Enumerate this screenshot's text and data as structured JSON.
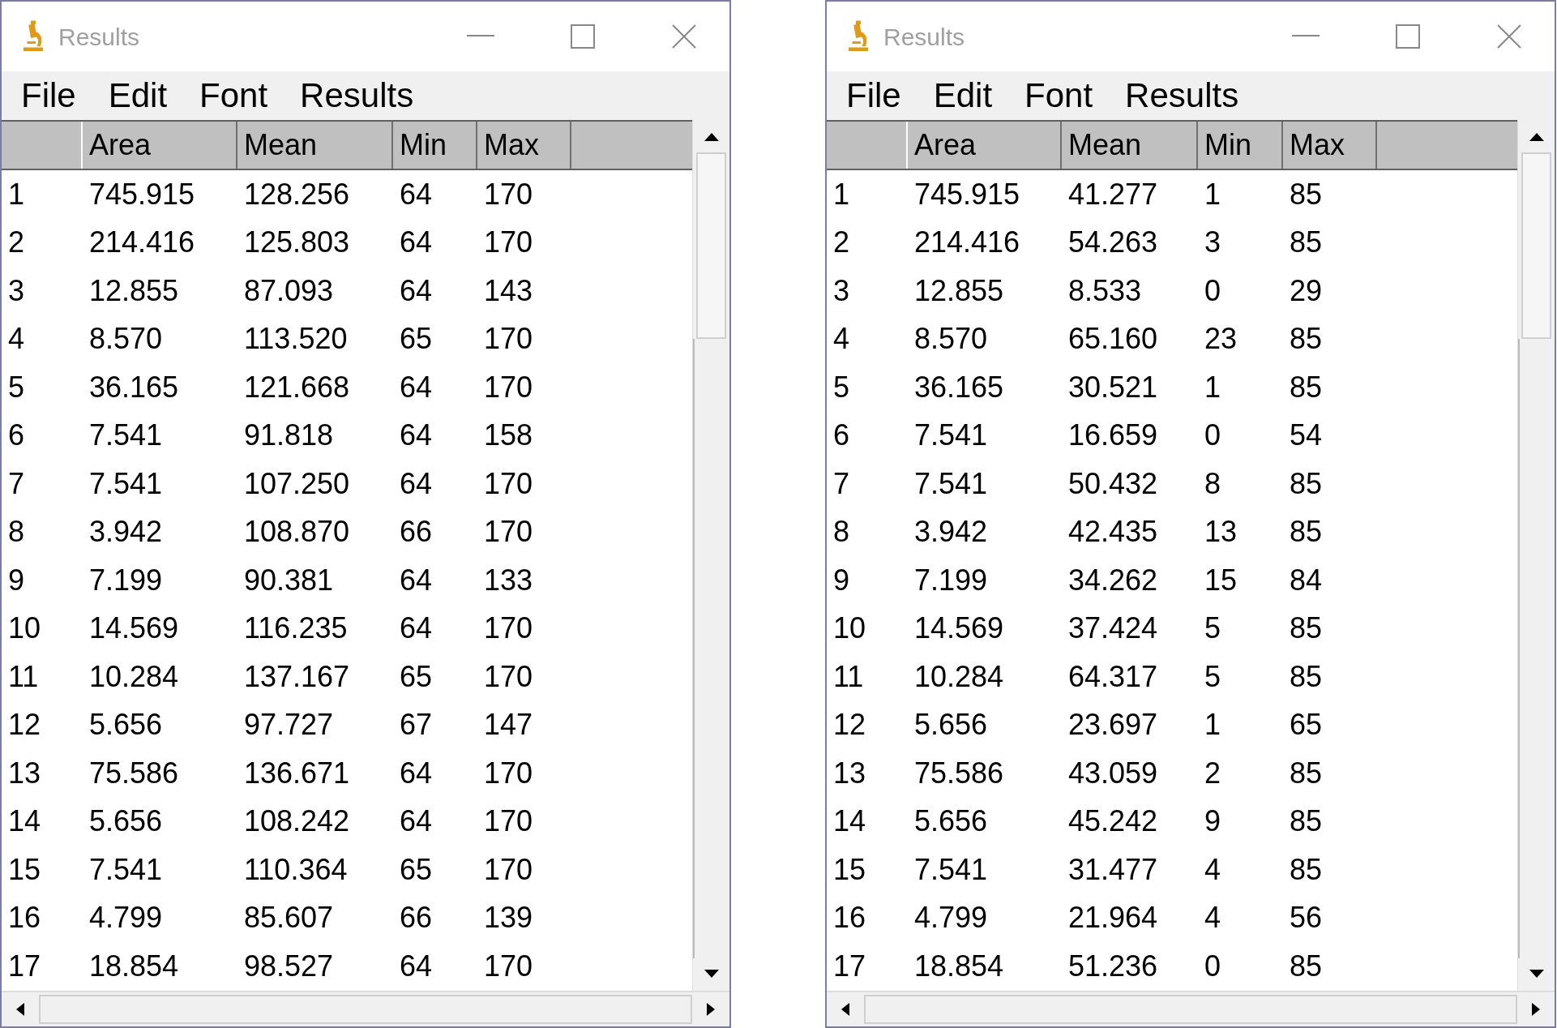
{
  "windows": [
    {
      "title": "Results",
      "menu": [
        "File",
        "Edit",
        "Font",
        "Results"
      ],
      "columns": [
        "",
        "Area",
        "Mean",
        "Min",
        "Max"
      ],
      "rows": [
        [
          "1",
          "745.915",
          "128.256",
          "64",
          "170"
        ],
        [
          "2",
          "214.416",
          "125.803",
          "64",
          "170"
        ],
        [
          "3",
          "12.855",
          "87.093",
          "64",
          "143"
        ],
        [
          "4",
          "8.570",
          "113.520",
          "65",
          "170"
        ],
        [
          "5",
          "36.165",
          "121.668",
          "64",
          "170"
        ],
        [
          "6",
          "7.541",
          "91.818",
          "64",
          "158"
        ],
        [
          "7",
          "7.541",
          "107.250",
          "64",
          "170"
        ],
        [
          "8",
          "3.942",
          "108.870",
          "66",
          "170"
        ],
        [
          "9",
          "7.199",
          "90.381",
          "64",
          "133"
        ],
        [
          "10",
          "14.569",
          "116.235",
          "64",
          "170"
        ],
        [
          "11",
          "10.284",
          "137.167",
          "65",
          "170"
        ],
        [
          "12",
          "5.656",
          "97.727",
          "67",
          "147"
        ],
        [
          "13",
          "75.586",
          "136.671",
          "64",
          "170"
        ],
        [
          "14",
          "5.656",
          "108.242",
          "64",
          "170"
        ],
        [
          "15",
          "7.541",
          "110.364",
          "65",
          "170"
        ],
        [
          "16",
          "4.799",
          "85.607",
          "66",
          "139"
        ],
        [
          "17",
          "18.854",
          "98.527",
          "64",
          "170"
        ]
      ]
    },
    {
      "title": "Results",
      "menu": [
        "File",
        "Edit",
        "Font",
        "Results"
      ],
      "columns": [
        "",
        "Area",
        "Mean",
        "Min",
        "Max"
      ],
      "rows": [
        [
          "1",
          "745.915",
          "41.277",
          "1",
          "85"
        ],
        [
          "2",
          "214.416",
          "54.263",
          "3",
          "85"
        ],
        [
          "3",
          "12.855",
          "8.533",
          "0",
          "29"
        ],
        [
          "4",
          "8.570",
          "65.160",
          "23",
          "85"
        ],
        [
          "5",
          "36.165",
          "30.521",
          "1",
          "85"
        ],
        [
          "6",
          "7.541",
          "16.659",
          "0",
          "54"
        ],
        [
          "7",
          "7.541",
          "50.432",
          "8",
          "85"
        ],
        [
          "8",
          "3.942",
          "42.435",
          "13",
          "85"
        ],
        [
          "9",
          "7.199",
          "34.262",
          "15",
          "84"
        ],
        [
          "10",
          "14.569",
          "37.424",
          "5",
          "85"
        ],
        [
          "11",
          "10.284",
          "64.317",
          "5",
          "85"
        ],
        [
          "12",
          "5.656",
          "23.697",
          "1",
          "65"
        ],
        [
          "13",
          "75.586",
          "43.059",
          "2",
          "85"
        ],
        [
          "14",
          "5.656",
          "45.242",
          "9",
          "85"
        ],
        [
          "15",
          "7.541",
          "31.477",
          "4",
          "85"
        ],
        [
          "16",
          "4.799",
          "21.964",
          "4",
          "56"
        ],
        [
          "17",
          "18.854",
          "51.236",
          "0",
          "85"
        ]
      ]
    }
  ]
}
